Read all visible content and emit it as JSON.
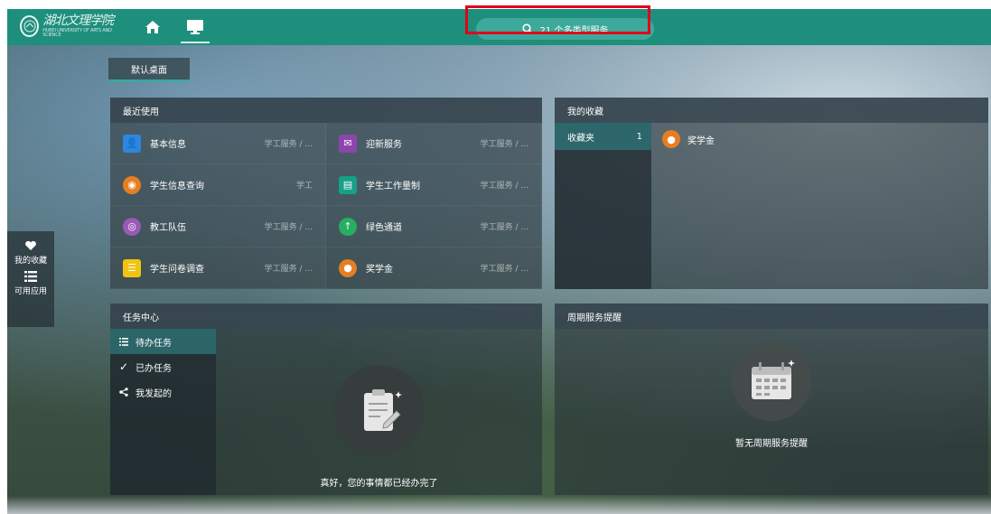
{
  "header": {
    "logo_text": "湖北文理学院",
    "logo_subtitle": "HUBEI UNIVERSITY OF ARTS AND SCIENCE",
    "search_label": "21 个多类型服务"
  },
  "desktop_tab": {
    "label": "默认桌面"
  },
  "dock": [
    {
      "label": "我的收藏",
      "icon": "heart-icon"
    },
    {
      "label": "可用应用",
      "icon": "list-icon"
    }
  ],
  "recent": {
    "title": "最近使用",
    "items": [
      {
        "name": "基本信息",
        "category": "学工服务 / ...",
        "icon": "profile-icon",
        "color": "#2e86de"
      },
      {
        "name": "迎新服务",
        "category": "学工服务 / ...",
        "icon": "welcome-icon",
        "color": "#8e44ad"
      },
      {
        "name": "学生信息查询",
        "category": "学工",
        "icon": "student-query-icon",
        "color": "#e67e22"
      },
      {
        "name": "学生工作量制",
        "category": "学工服务 / ...",
        "icon": "workload-icon",
        "color": "#16a085"
      },
      {
        "name": "教工队伍",
        "category": "学工服务 / ...",
        "icon": "staff-icon",
        "color": "#9b59b6"
      },
      {
        "name": "绿色通道",
        "category": "学工服务 / ...",
        "icon": "green-channel-icon",
        "color": "#27ae60"
      },
      {
        "name": "学生问卷调查",
        "category": "学工服务 / ...",
        "icon": "survey-icon",
        "color": "#f1c40f"
      },
      {
        "name": "奖学金",
        "category": "学工服务 / ...",
        "icon": "scholarship-icon",
        "color": "#e67e22"
      }
    ]
  },
  "favorites": {
    "title": "我的收藏",
    "folder": {
      "name": "收藏夹",
      "count": "1"
    },
    "items": [
      {
        "name": "奖学金",
        "icon": "scholarship-icon",
        "color": "#e67e22"
      }
    ]
  },
  "tasks": {
    "title": "任务中心",
    "tabs": [
      {
        "label": "待办任务",
        "icon": "todo-list-icon"
      },
      {
        "label": "已办任务",
        "icon": "check-icon"
      },
      {
        "label": "我发起的",
        "icon": "share-icon"
      }
    ],
    "empty_text": "真好，您的事情都已经办完了"
  },
  "reminders": {
    "title": "周期服务提醒",
    "empty_text": "暂无周期服务提醒"
  },
  "colors": {
    "accent": "#1e8f7d",
    "highlight_box": "#e0001b"
  }
}
